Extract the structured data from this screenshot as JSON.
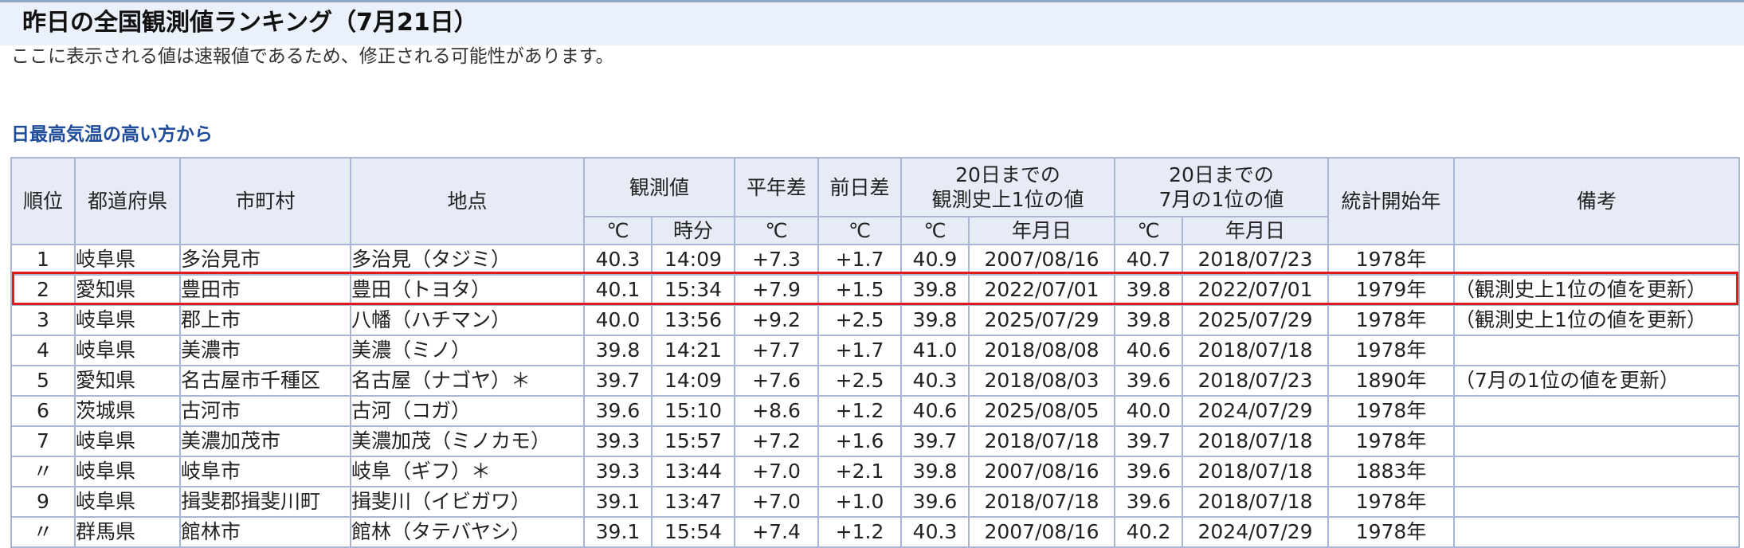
{
  "page": {
    "title": "昨日の全国観測値ランキング（7月21日）",
    "notice": "ここに表示される値は速報値であるため、修正される可能性があります。",
    "section_heading": "日最高気温の高い方から"
  },
  "table": {
    "headers": {
      "rank": "順位",
      "prefecture": "都道府県",
      "municipality": "市町村",
      "station": "地点",
      "observed": "観測値",
      "normal_diff": "平年差",
      "prev_day_diff": "前日差",
      "record_all_line1": "20日までの",
      "record_all_line2": "観測史上1位の値",
      "record_july_line1": "20日までの",
      "record_july_line2": "7月の1位の値",
      "stats_start": "統計開始年",
      "remarks": "備考"
    },
    "subheaders": {
      "observed_temp": "℃",
      "observed_time": "時分",
      "normal_diff_unit": "℃",
      "prev_day_diff_unit": "℃",
      "record_all_temp": "℃",
      "record_all_date": "年月日",
      "record_july_temp": "℃",
      "record_july_date": "年月日"
    },
    "highlight_color": "#e01b1b",
    "rows": [
      {
        "rank": "1",
        "prefecture": "岐阜県",
        "municipality": "多治見市",
        "station": "多治見（タジミ）",
        "temp": "40.3",
        "time": "14:09",
        "normal_diff": "+7.3",
        "prev_diff": "+1.7",
        "rec_all_temp": "40.9",
        "rec_all_date": "2007/08/16",
        "rec_july_temp": "40.7",
        "rec_july_date": "2018/07/23",
        "start_year": "1978年",
        "remarks": ""
      },
      {
        "rank": "2",
        "prefecture": "愛知県",
        "municipality": "豊田市",
        "station": "豊田（トヨタ）",
        "temp": "40.1",
        "time": "15:34",
        "normal_diff": "+7.9",
        "prev_diff": "+1.5",
        "rec_all_temp": "39.8",
        "rec_all_date": "2022/07/01",
        "rec_july_temp": "39.8",
        "rec_july_date": "2022/07/01",
        "start_year": "1979年",
        "remarks": "（観測史上1位の値を更新）"
      },
      {
        "rank": "3",
        "prefecture": "岐阜県",
        "municipality": "郡上市",
        "station": "八幡（ハチマン）",
        "temp": "40.0",
        "time": "13:56",
        "normal_diff": "+9.2",
        "prev_diff": "+2.5",
        "rec_all_temp": "39.8",
        "rec_all_date": "2025/07/29",
        "rec_july_temp": "39.8",
        "rec_july_date": "2025/07/29",
        "start_year": "1978年",
        "remarks": "（観測史上1位の値を更新）"
      },
      {
        "rank": "4",
        "prefecture": "岐阜県",
        "municipality": "美濃市",
        "station": "美濃（ミノ）",
        "temp": "39.8",
        "time": "14:21",
        "normal_diff": "+7.7",
        "prev_diff": "+1.7",
        "rec_all_temp": "41.0",
        "rec_all_date": "2018/08/08",
        "rec_july_temp": "40.6",
        "rec_july_date": "2018/07/18",
        "start_year": "1978年",
        "remarks": ""
      },
      {
        "rank": "5",
        "prefecture": "愛知県",
        "municipality": "名古屋市千種区",
        "station": "名古屋（ナゴヤ）＊",
        "temp": "39.7",
        "time": "14:09",
        "normal_diff": "+7.6",
        "prev_diff": "+2.5",
        "rec_all_temp": "40.3",
        "rec_all_date": "2018/08/03",
        "rec_july_temp": "39.6",
        "rec_july_date": "2018/07/23",
        "start_year": "1890年",
        "remarks": "（7月の1位の値を更新）"
      },
      {
        "rank": "6",
        "prefecture": "茨城県",
        "municipality": "古河市",
        "station": "古河（コガ）",
        "temp": "39.6",
        "time": "15:10",
        "normal_diff": "+8.6",
        "prev_diff": "+1.2",
        "rec_all_temp": "40.6",
        "rec_all_date": "2025/08/05",
        "rec_july_temp": "40.0",
        "rec_july_date": "2024/07/29",
        "start_year": "1978年",
        "remarks": ""
      },
      {
        "rank": "7",
        "prefecture": "岐阜県",
        "municipality": "美濃加茂市",
        "station": "美濃加茂（ミノカモ）",
        "temp": "39.3",
        "time": "15:57",
        "normal_diff": "+7.2",
        "prev_diff": "+1.6",
        "rec_all_temp": "39.7",
        "rec_all_date": "2018/07/18",
        "rec_july_temp": "39.7",
        "rec_july_date": "2018/07/18",
        "start_year": "1978年",
        "remarks": ""
      },
      {
        "rank": "〃",
        "prefecture": "岐阜県",
        "municipality": "岐阜市",
        "station": "岐阜（ギフ）＊",
        "temp": "39.3",
        "time": "13:44",
        "normal_diff": "+7.0",
        "prev_diff": "+2.1",
        "rec_all_temp": "39.8",
        "rec_all_date": "2007/08/16",
        "rec_july_temp": "39.6",
        "rec_july_date": "2018/07/18",
        "start_year": "1883年",
        "remarks": ""
      },
      {
        "rank": "9",
        "prefecture": "岐阜県",
        "municipality": "揖斐郡揖斐川町",
        "station": "揖斐川（イビガワ）",
        "temp": "39.1",
        "time": "13:47",
        "normal_diff": "+7.0",
        "prev_diff": "+1.0",
        "rec_all_temp": "39.6",
        "rec_all_date": "2018/07/18",
        "rec_july_temp": "39.6",
        "rec_july_date": "2018/07/18",
        "start_year": "1978年",
        "remarks": ""
      },
      {
        "rank": "〃",
        "prefecture": "群馬県",
        "municipality": "館林市",
        "station": "館林（タテバヤシ）",
        "temp": "39.1",
        "time": "15:54",
        "normal_diff": "+7.4",
        "prev_diff": "+1.2",
        "rec_all_temp": "40.3",
        "rec_all_date": "2007/08/16",
        "rec_july_temp": "40.2",
        "rec_july_date": "2024/07/29",
        "start_year": "1978年",
        "remarks": ""
      }
    ]
  }
}
